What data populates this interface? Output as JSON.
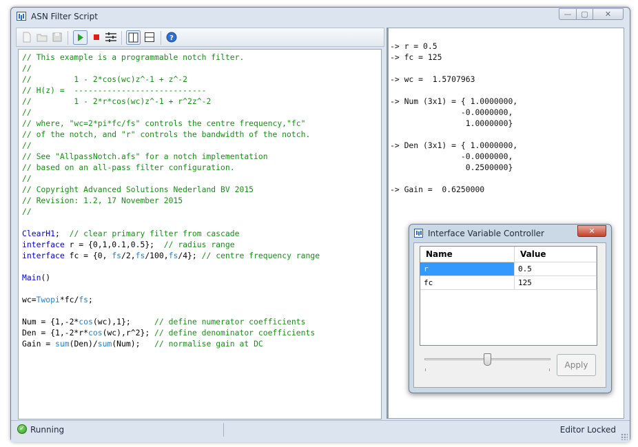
{
  "window": {
    "title": "ASN Filter Script",
    "min_glyph": "—",
    "max_glyph": "▢",
    "close_glyph": "✕"
  },
  "toolbar": {
    "icons": [
      "new-file-icon",
      "open-folder-icon",
      "save-icon",
      "run-icon",
      "stop-icon",
      "variables-icon",
      "split-vertical-icon",
      "split-horizontal-icon",
      "help-icon"
    ],
    "help_glyph": "?"
  },
  "editor": {
    "lines": [
      {
        "c": "// This example is a programmable notch filter."
      },
      {
        "c": "//"
      },
      {
        "c": "//         1 - 2*cos(wc)z^-1 + z^-2"
      },
      {
        "c": "// H(z) =  ----------------------------"
      },
      {
        "c": "//         1 - 2*r*cos(wc)z^-1 + r^2z^-2"
      },
      {
        "c": "//"
      },
      {
        "c": "// where, \"wc=2*pi*fc/fs\" controls the centre frequency,\"fc\""
      },
      {
        "c": "// of the notch, and \"r\" controls the bandwidth of the notch."
      },
      {
        "c": "//"
      },
      {
        "c": "// See \"AllpassNotch.afs\" for a notch implementation"
      },
      {
        "c": "// based on an all-pass filter configuration."
      },
      {
        "c": "//"
      },
      {
        "c": "// Copyright Advanced Solutions Nederland BV 2015"
      },
      {
        "c": "// Revision: 1.2, 17 November 2015"
      },
      {
        "c": "//"
      },
      {
        "n": ""
      },
      {
        "k": "ClearH1",
        "n": ";  ",
        "c": "// clear primary filter from cascade"
      },
      {
        "k": "interface",
        "n": " r = {0,1,0.1,0.5};  ",
        "c": "// radius range"
      },
      {
        "k": "interface",
        "n": " fc = {0, ",
        "f": "fs",
        "n2": "/2,",
        "f2": "fs",
        "n3": "/100,",
        "f3": "fs",
        "n4": "/4}; ",
        "c": "// centre frequency range"
      },
      {
        "n": ""
      },
      {
        "k": "Main",
        "n": "()"
      },
      {
        "n": ""
      },
      {
        "n": "wc=",
        "f": "Twopi",
        "n2": "*fc/",
        "f2": "fs",
        "n3": ";"
      },
      {
        "n": ""
      },
      {
        "n": "Num = {1,-2*",
        "f": "cos",
        "n2": "(wc),1};     ",
        "c": "// define numerator coefficients"
      },
      {
        "n": "Den = {1,-2*r*",
        "f": "cos",
        "n2": "(wc),r^2}; ",
        "c": "// define denominator coefficients"
      },
      {
        "n": "Gain = ",
        "f": "sum",
        "n2": "(Den)/",
        "f2": "sum",
        "n3": "(Num);   ",
        "c": "// normalise gain at DC"
      }
    ]
  },
  "output": {
    "text": "-> r = 0.5\n-> fc = 125\n\n-> wc =  1.5707963\n\n-> Num (3x1) = { 1.0000000,\n               -0.0000000,\n                1.0000000}\n\n-> Den (3x1) = { 1.0000000,\n               -0.0000000,\n                0.2500000}\n\n-> Gain =  0.6250000"
  },
  "status": {
    "left": "Running",
    "right": "Editor Locked",
    "ok_glyph": "✓"
  },
  "dialog": {
    "title": "Interface Variable Controller",
    "close_glyph": "✕",
    "columns": [
      "Name",
      "Value"
    ],
    "rows": [
      {
        "name": "r",
        "value": "0.5",
        "selected": true
      },
      {
        "name": "fc",
        "value": "125",
        "selected": false
      }
    ],
    "slider_level": 0.5,
    "apply_label": "Apply"
  },
  "colors": {
    "comment": "#1a8c1a",
    "keyword": "#0000e0",
    "function": "#2c7fc0",
    "selection": "#3399ff"
  }
}
